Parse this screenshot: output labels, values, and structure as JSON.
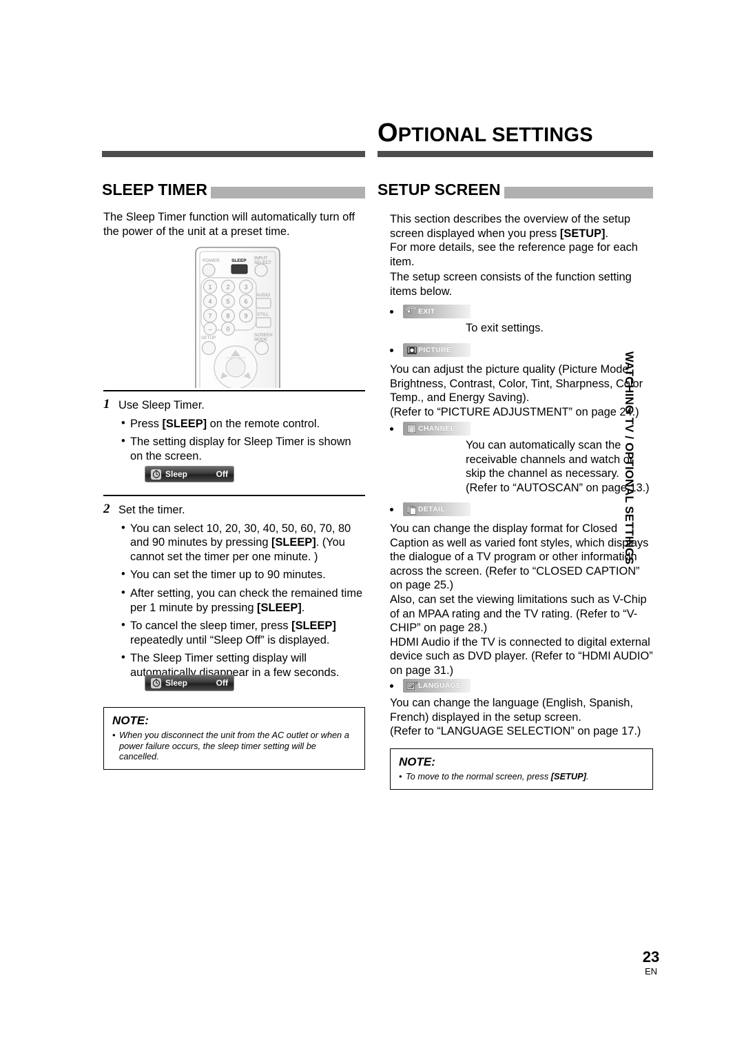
{
  "chapter": {
    "drop_cap": "O",
    "rest": "PTIONAL SETTINGS"
  },
  "left_column": {
    "section_title": "SLEEP TIMER",
    "intro": "The Sleep Timer function will automatically turn off the power of the unit at a preset time.",
    "remote": {
      "power_label": "POWER",
      "sleep_label": "SLEEP",
      "input_select_label": "INPUT SELECT",
      "audio_label": "AUDIO",
      "still_label": "STILL",
      "setup_label": "SETUP",
      "screen_mode_label": "SCREEN MODE",
      "keys": [
        "1",
        "2",
        "3",
        "4",
        "5",
        "6",
        "7",
        "8",
        "9",
        "–",
        "0"
      ]
    },
    "steps": [
      {
        "number": "1",
        "heading": "Use Sleep Timer.",
        "bullets": [
          "Press [SLEEP] on the remote control.",
          "The setting display for Sleep Timer is shown on the screen."
        ]
      },
      {
        "number": "2",
        "heading": "Set the timer.",
        "bullets": [
          "You can select 10, 20, 30, 40, 50, 60, 70, 80 and 90 minutes by pressing [SLEEP]. (You cannot set the timer per one minute. )",
          "You can set the timer up to 90 minutes.",
          "After setting, you can check the remained time per 1 minute by pressing [SLEEP].",
          "To cancel the sleep timer, press [SLEEP] repeatedly until “Sleep Off” is displayed.",
          "The Sleep Timer setting display will automatically disappear in a few seconds."
        ]
      }
    ],
    "osd": {
      "icon": "clock-icon",
      "label": "Sleep",
      "value": "Off"
    },
    "note": {
      "title": "NOTE:",
      "body": "When you disconnect the unit from the AC outlet or when a power failure occurs, the sleep timer setting will be cancelled."
    }
  },
  "right_column": {
    "section_title": "SETUP SCREEN",
    "intro_1": "This section describes the overview of the setup screen displayed when you press [SETUP].",
    "intro_2": "For more details, see the reference page for each item.",
    "intro_3": "The setup screen consists of the function setting items below.",
    "items": [
      {
        "icon": "exit-icon",
        "chip_label": "EXIT",
        "description": "To exit settings."
      },
      {
        "icon": "picture-icon",
        "chip_label": "PICTURE",
        "description": "You can adjust the picture quality (Picture Mode, Brightness, Contrast, Color, Tint, Sharpness, Color Temp., and Energy Saving).\n(Refer to “PICTURE ADJUSTMENT” on page 24.)"
      },
      {
        "icon": "channel-icon",
        "chip_label": "CHANNEL",
        "description": "You can automatically scan the receivable channels and watch or skip the channel as necessary.\n(Refer to “AUTOSCAN” on page 13.)"
      },
      {
        "icon": "detail-icon",
        "chip_label": "DETAIL",
        "description": "You can change the display format for Closed Caption as well as varied font styles, which displays the dialogue of a TV program or other information across the screen. (Refer to “CLOSED CAPTION” on page 25.)\nAlso, can set the viewing limitations such as V-Chip of an MPAA rating and the TV rating. (Refer to “V-CHIP” on page 28.)\nHDMI Audio if the TV is connected to digital external device such as DVD player. (Refer to “HDMI AUDIO” on page 31.)"
      },
      {
        "icon": "language-icon",
        "chip_label": "LANGUAGE",
        "description": "You can change the language (English, Spanish, French) displayed in the setup screen.\n(Refer to “LANGUAGE SELECTION” on page 17.)"
      }
    ],
    "note": {
      "title": "NOTE:",
      "body": "To move to the normal screen, press [SETUP]."
    }
  },
  "side_tab": "WATCHING TV / OPTIONAL SETTINGS",
  "folio": {
    "number": "23",
    "lang": "EN"
  },
  "colors": {
    "rule": "#4d4d4d",
    "section_bar": "#b0b0b0",
    "text": "#000000"
  }
}
